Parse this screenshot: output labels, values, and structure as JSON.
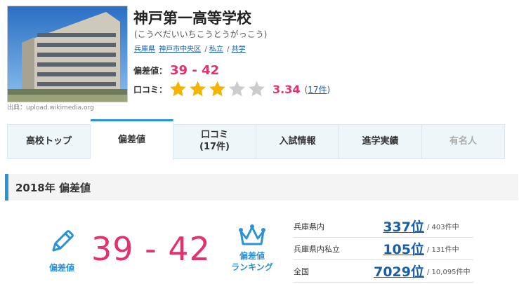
{
  "school": {
    "name": "神戸第一高等学校",
    "kana": "(こうべだいいちこうとうがっこう)",
    "tags": [
      "兵庫県",
      "神戸市中央区",
      "私立",
      "共学"
    ],
    "photo_credit": "出典：upload.wikimedia.org"
  },
  "deviation": {
    "label": "偏差値：",
    "value": "39 - 42"
  },
  "review": {
    "label": "口コミ：",
    "score": "3.34",
    "count_open": "(",
    "count_link": "17件",
    "count_close": ")",
    "stars_rating": 3
  },
  "tabs": [
    {
      "label": "高校トップ",
      "state": "normal"
    },
    {
      "label": "偏差値",
      "state": "active"
    },
    {
      "label": "口コミ\n(17件)",
      "state": "normal"
    },
    {
      "label": "入試情報",
      "state": "normal"
    },
    {
      "label": "進学実績",
      "state": "normal"
    },
    {
      "label": "有名人",
      "state": "disabled"
    }
  ],
  "section": {
    "heading": "2018年 偏差値"
  },
  "summary": {
    "pencil_caption": "偏差値",
    "big_value": "39 - 42",
    "ranking_caption_1": "偏差値",
    "ranking_caption_2": "ランキング"
  },
  "ranks": [
    {
      "area": "兵庫県内",
      "rank": "337位",
      "total": "/ 403件中"
    },
    {
      "area": "兵庫県内私立",
      "rank": "105位",
      "total": "/ 131件中"
    },
    {
      "area": "全国",
      "rank": "7029位",
      "total": "/ 10,095件中"
    }
  ],
  "colors": {
    "accent_blue": "#2a93d8",
    "accent_pink": "#e5306c",
    "star_gold": "#f3b400",
    "star_gray": "#cccccc"
  }
}
